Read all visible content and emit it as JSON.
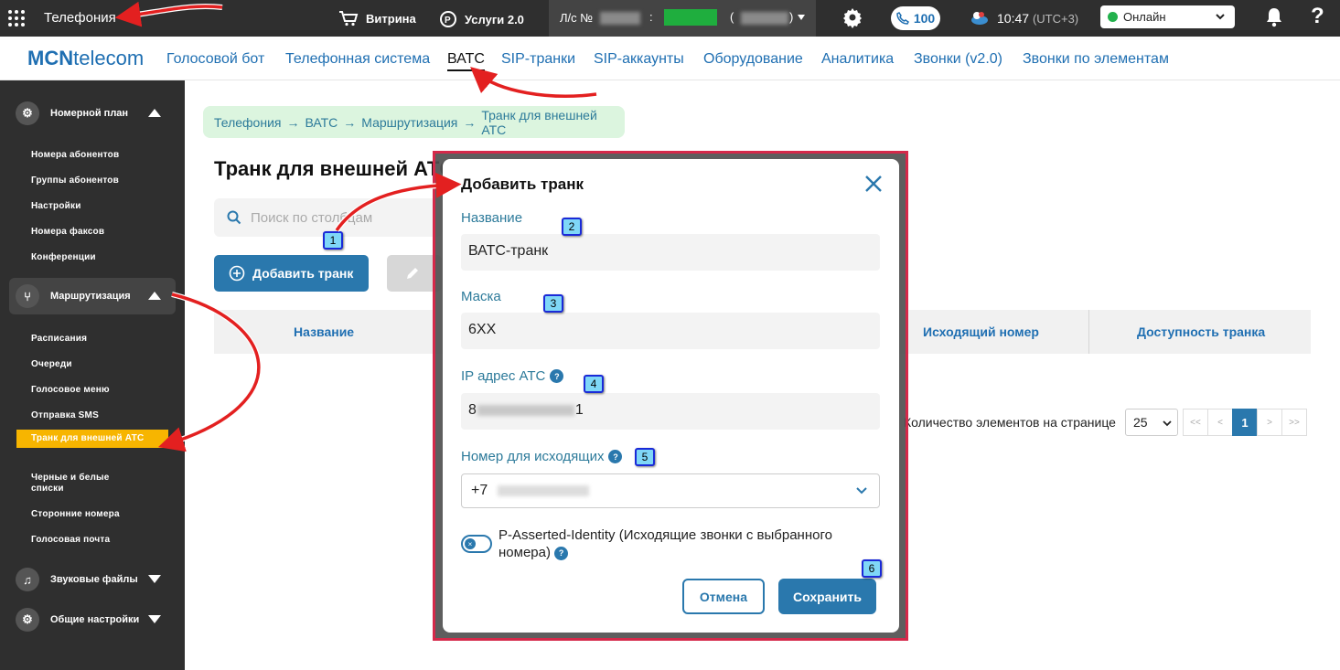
{
  "topbar": {
    "app_title": "Телефония",
    "vitrina": "Витрина",
    "services": "Услуги 2.0",
    "account_prefix": "Л/с №",
    "account_colon": ":",
    "account_paren_open": "(",
    "account_paren_close": ")",
    "calls_count": "100",
    "time": "10:47",
    "timezone": "(UTC+3)",
    "status": "Онлайн"
  },
  "nav": {
    "logo_bold": "MCN",
    "logo_rest": "telecom",
    "tabs": [
      {
        "label": "Голосовой бот"
      },
      {
        "label": "Телефонная система"
      },
      {
        "label": "ВАТС"
      },
      {
        "label": "SIP-транки"
      },
      {
        "label": "SIP-аккаунты"
      },
      {
        "label": "Оборудование"
      },
      {
        "label": "Аналитика"
      },
      {
        "label": "Звонки (v2.0)"
      },
      {
        "label": "Звонки по элементам"
      }
    ]
  },
  "sidebar": {
    "groups": [
      {
        "label": "Номерной план"
      },
      {
        "label": "Маршрутизация"
      },
      {
        "label": "Звуковые файлы"
      },
      {
        "label": "Общие настройки"
      }
    ],
    "items": [
      {
        "label": "Номера абонентов"
      },
      {
        "label": "Группы абонентов"
      },
      {
        "label": "Настройки"
      },
      {
        "label": "Номера факсов"
      },
      {
        "label": "Конференции"
      },
      {
        "label": "Расписания"
      },
      {
        "label": "Очереди"
      },
      {
        "label": "Голосовое меню"
      },
      {
        "label": "Отправка SMS"
      },
      {
        "label": "Транк для внешней АТС"
      },
      {
        "label": "Черные и белые списки"
      },
      {
        "label": "Сторонние номера"
      },
      {
        "label": "Голосовая почта"
      }
    ]
  },
  "breadcrumb": [
    "Телефония",
    "ВАТС",
    "Маршрутизация",
    "Транк для внешней АТС"
  ],
  "breadcrumb_sep": "→",
  "page": {
    "title": "Транк для внешней АТС",
    "search_placeholder": "Поиск по столбцам",
    "add_button": "Добавить транк",
    "columns": [
      "Название",
      "Исходящий номер",
      "Доступность транка"
    ],
    "page_size_label": "Количество элементов на странице",
    "page_size": "25",
    "pager": {
      "first": "<<",
      "prev": "<",
      "current": "1",
      "next": ">",
      "last": ">>"
    }
  },
  "modal": {
    "title": "Добавить транк",
    "name_label": "Название",
    "name_value": "ВАТС-транк",
    "mask_label": "Маска",
    "mask_value": "6XX",
    "ip_label": "IP адрес АТС",
    "ip_value_start": "8",
    "ip_value_end": "1",
    "outgoing_label": "Номер для исходящих",
    "outgoing_value": "+7",
    "pai_label": "P-Asserted-Identity (Исходящие звонки с выбранного номера)",
    "cancel": "Отмена",
    "save": "Сохранить",
    "help": "?",
    "toggle_off": "×"
  },
  "annotations": [
    "1",
    "2",
    "3",
    "4",
    "5",
    "6"
  ],
  "colors": {
    "accent": "#2a78ad",
    "highlight_frame": "#d5294a",
    "active_sidebar": "#f7b500",
    "arrow": "#e32020"
  }
}
